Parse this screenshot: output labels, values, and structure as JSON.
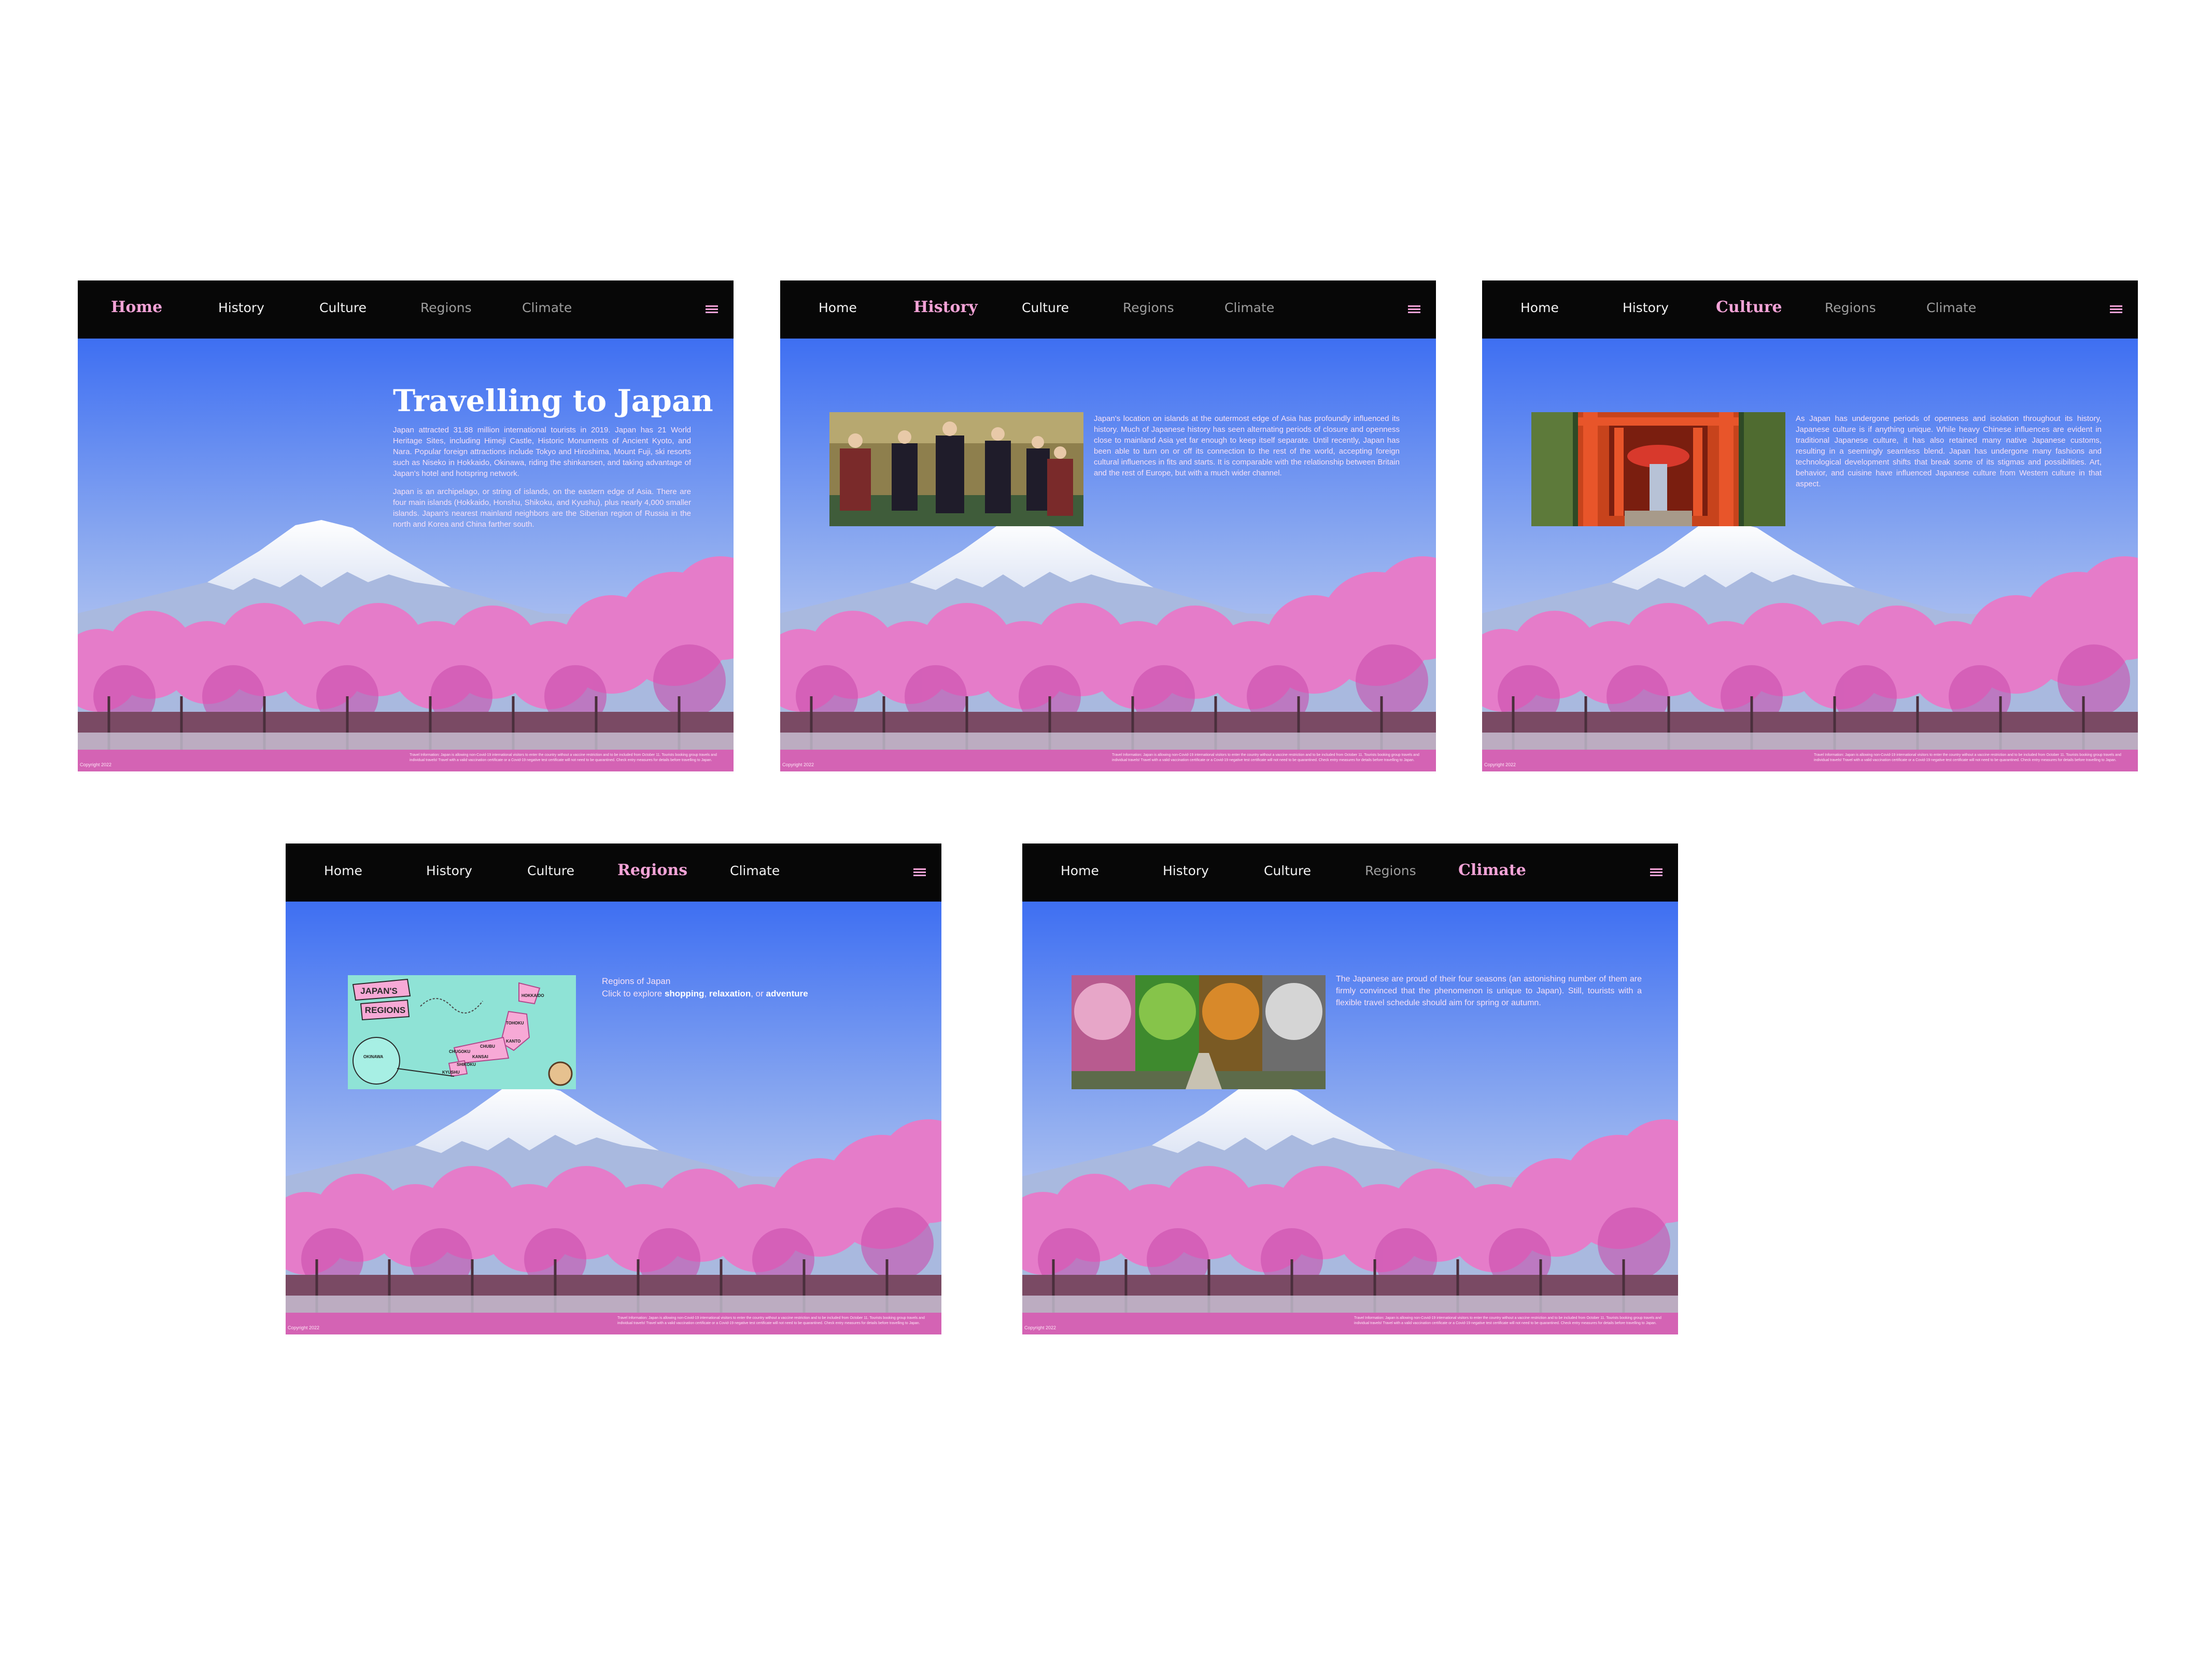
{
  "nav": {
    "home": "Home",
    "history": "History",
    "culture": "Culture",
    "regions": "Regions",
    "climate": "Climate"
  },
  "footer": {
    "copyright": "Copyright 2022",
    "note": "Travel Information: Japan is allowing non-Covid-19 international visitors to enter the country without a vaccine restriction and to be included from October 11. Tourists booking group travels and individual travels! Travel with a valid vaccination certificate or a Covid-19 negative test certificate will not need to be quarantined. Check entry measures for details before travelling to Japan."
  },
  "home": {
    "title": "Travelling to Japan",
    "paragraph1": "Japan attracted 31.88 million international tourists in 2019. Japan has 21 World Heritage Sites, including Himeji Castle, Historic Monuments of Ancient Kyoto, and Nara. Popular foreign attractions include Tokyo and Hiroshima, Mount Fuji, ski resorts such as Niseko in Hokkaido, Okinawa, riding the shinkansen, and taking advantage of Japan's hotel and hotspring network.",
    "paragraph2": "Japan is an archipelago, or string of islands, on the eastern edge of Asia. There are four main islands (Hokkaido, Honshu, Shikoku, and Kyushu), plus nearly 4,000 smaller islands. Japan's nearest mainland neighbors are the Siberian region of Russia in the north and Korea and China farther south."
  },
  "history": {
    "text": "Japan's location on islands at the outermost edge of Asia has profoundly influenced its history. Much of Japanese history has seen alternating periods of closure and openness close to mainland Asia yet far enough to keep itself separate. Until recently, Japan has been able to turn on or off its connection to the rest of the world, accepting foreign cultural influences in fits and starts. It is comparable with the relationship between Britain and the rest of Europe, but with a much wider channel."
  },
  "culture": {
    "text": "As Japan has undergone periods of openness and isolation throughout its history, Japanese culture is if anything unique. While heavy Chinese influences are evident in traditional Japanese culture, it has also retained many native Japanese customs, resulting in a seemingly seamless blend. Japan has undergone many fashions and technological development shifts that break some of its stigmas and possibilities. Art, behavior, and cuisine have influenced Japanese culture from Western culture in that aspect."
  },
  "regions": {
    "heading": "Regions of Japan",
    "prompt": "Click to explore",
    "link1": "shopping",
    "link2": "relaxation",
    "link3": "adventure",
    "sep1": ", ",
    "sep2": ", or ",
    "map_title_line1": "JAPAN'S",
    "map_title_line2": "REGIONS",
    "map_labels": [
      "HOKKAIDO",
      "TOHOKU",
      "KANTO",
      "CHUBU",
      "KANSAI",
      "CHUGOKU",
      "SHIKOKU",
      "KYUSHU",
      "OKINAWA"
    ]
  },
  "climate": {
    "text": "The Japanese are proud of their four seasons (an astonishing number of them are firmly convinced that the phenomenon is unique to Japan). Still, tourists with a flexible travel schedule should aim for spring or autumn."
  }
}
